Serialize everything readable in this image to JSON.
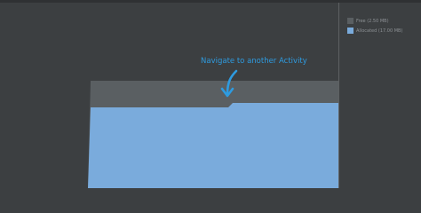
{
  "colors": {
    "background": "#3c3f41",
    "free": "#5a5f62",
    "allocated": "#7aabdc",
    "annotation": "#2e9be0",
    "legend_text": "#8d9195"
  },
  "legend": {
    "items": [
      {
        "label": "Free (2.50 MB)",
        "color": "#5a5f62"
      },
      {
        "label": "Allocated (17.00 MB)",
        "color": "#7aabdc"
      }
    ]
  },
  "annotation": {
    "text": "Navigate to another Activity",
    "icon": "curved-arrow-down-icon"
  }
}
